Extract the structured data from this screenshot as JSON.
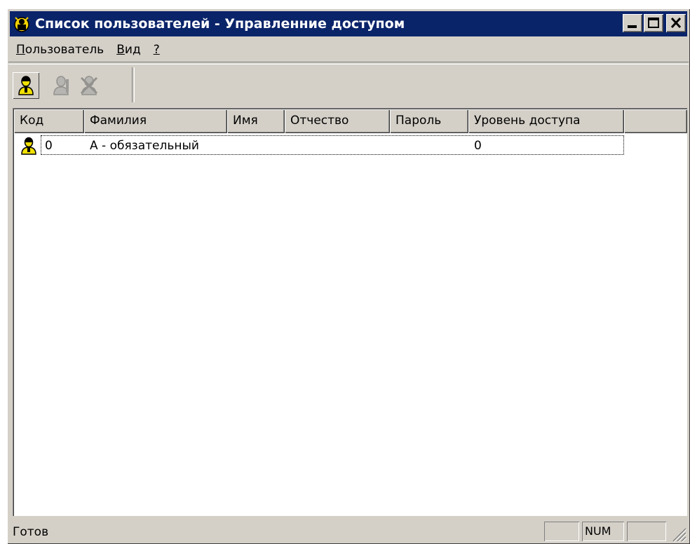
{
  "window": {
    "title": "Список пользователей - Управленние доступом",
    "title_bar_color": "#0a246a",
    "face_color": "#d4d0c8"
  },
  "menu": [
    {
      "label": "Пользователь",
      "mnemonic": "П",
      "rest": "ользователь"
    },
    {
      "label": "Вид",
      "mnemonic": "В",
      "rest": "ид"
    },
    {
      "label": "?",
      "mnemonic": "?",
      "rest": ""
    }
  ],
  "toolbar": {
    "buttons": [
      {
        "name": "add-user",
        "icon": "user-add-icon",
        "enabled": true
      },
      {
        "name": "edit-user",
        "icon": "user-edit-icon",
        "enabled": false
      },
      {
        "name": "delete-user",
        "icon": "user-delete-icon",
        "enabled": false
      }
    ]
  },
  "table": {
    "columns": [
      "Код",
      "Фамилия",
      "Имя",
      "Отчество",
      "Пароль",
      "Уровень доступа"
    ],
    "rows": [
      {
        "code": "0",
        "surname": "А - обязательный",
        "name": "",
        "patronymic": "",
        "password": "",
        "access_level": "0",
        "icon": "user-icon"
      }
    ]
  },
  "status": {
    "text": "Готов",
    "panel1": "",
    "panel2": "NUM",
    "panel3": ""
  }
}
